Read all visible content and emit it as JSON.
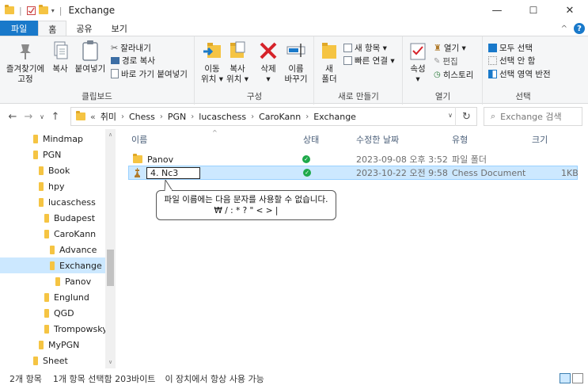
{
  "window": {
    "title": "Exchange",
    "minimize": "—",
    "maximize": "☐",
    "close": "✕"
  },
  "ribbon_tabs": [
    "파일",
    "홈",
    "공유",
    "보기"
  ],
  "ribbon": {
    "clipboard": {
      "label": "클립보드",
      "pin": "즐겨찾기에\n고정",
      "copy": "복사",
      "paste": "붙여넣기",
      "cut": "잘라내기",
      "copy_path": "경로 복사",
      "paste_shortcut": "바로 가기 붙여넣기"
    },
    "organize": {
      "label": "구성",
      "move_to": "이동\n위치 ▾",
      "copy_to": "복사\n위치 ▾",
      "delete": "삭제\n▾",
      "rename": "이름\n바꾸기"
    },
    "new": {
      "label": "새로 만들기",
      "new_folder": "새\n폴더",
      "new_item": "새 항목 ▾",
      "easy_access": "빠른 연결 ▾"
    },
    "open": {
      "label": "열기",
      "properties": "속성\n▾",
      "open": "열기 ▾",
      "edit": "편집",
      "history": "히스토리"
    },
    "select": {
      "label": "선택",
      "select_all": "모두 선택",
      "select_none": "선택 안 함",
      "invert": "선택 영역 반전"
    }
  },
  "address": {
    "overflow": "«",
    "crumbs": [
      "취미",
      "Chess",
      "PGN",
      "lucaschess",
      "CaroKann",
      "Exchange"
    ],
    "search_placeholder": "Exchange 검색"
  },
  "nav": {
    "items": [
      {
        "label": "Mindmap",
        "indent": 0
      },
      {
        "label": "PGN",
        "indent": 0
      },
      {
        "label": "Book",
        "indent": 1
      },
      {
        "label": "hpy",
        "indent": 1
      },
      {
        "label": "lucaschess",
        "indent": 1
      },
      {
        "label": "Budapest",
        "indent": 2
      },
      {
        "label": "CaroKann",
        "indent": 2
      },
      {
        "label": "Advance",
        "indent": 3
      },
      {
        "label": "Exchange",
        "indent": 3
      },
      {
        "label": "Panov",
        "indent": 4
      },
      {
        "label": "Englund",
        "indent": 2
      },
      {
        "label": "QGD",
        "indent": 2
      },
      {
        "label": "Trompowsky",
        "indent": 2
      },
      {
        "label": "MyPGN",
        "indent": 1
      },
      {
        "label": "Sheet",
        "indent": 0
      }
    ]
  },
  "columns": {
    "name": "이름",
    "status": "상태",
    "modified": "수정한 날짜",
    "type": "유형",
    "size": "크기"
  },
  "files": [
    {
      "name": "Panov",
      "status": "✓",
      "modified": "2023-09-08 오후 3:52",
      "type": "파일 폴더",
      "size": ""
    },
    {
      "name": "4. Nc3",
      "status": "✓",
      "modified": "2023-10-22 오전 9:58",
      "type": "Chess Document",
      "size": "1KB"
    }
  ],
  "tooltip": {
    "line1": "파일 이름에는 다음 문자를 사용할 수 없습니다.",
    "line2": "₩ / : * ? \" < > |"
  },
  "statusbar": {
    "count": "2개 항목",
    "selected": "1개 항목 선택함 203바이트",
    "availability": "이 장치에서 항상 사용 가능"
  }
}
